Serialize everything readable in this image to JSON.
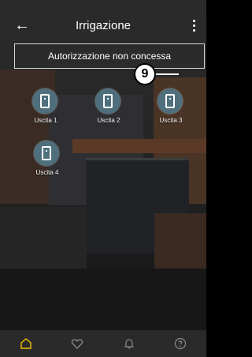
{
  "header": {
    "title": "Irrigazione",
    "back_icon": "back-arrow-icon",
    "more_icon": "more-vertical-icon"
  },
  "banner": {
    "text": "Autorizzazione non concessa"
  },
  "step_badge": {
    "number": "9"
  },
  "outlets": [
    {
      "label": "Uscita 1",
      "icon": "door-icon"
    },
    {
      "label": "Uscita 2",
      "icon": "door-icon"
    },
    {
      "label": "Uscita 3",
      "icon": "door-icon"
    },
    {
      "label": "Uscita 4",
      "icon": "door-icon"
    }
  ],
  "bottom_nav": {
    "items": [
      {
        "icon": "home-icon",
        "active": true
      },
      {
        "icon": "heart-icon",
        "active": false
      },
      {
        "icon": "bell-icon",
        "active": false
      },
      {
        "icon": "help-icon",
        "active": false
      }
    ],
    "active_color": "#f2c200",
    "inactive_color": "#8a8a8a"
  },
  "colors": {
    "outlet_circle": "#4f6f7d",
    "banner_bg": "#2b2b2b",
    "nav_bg": "#2a2a2a"
  }
}
